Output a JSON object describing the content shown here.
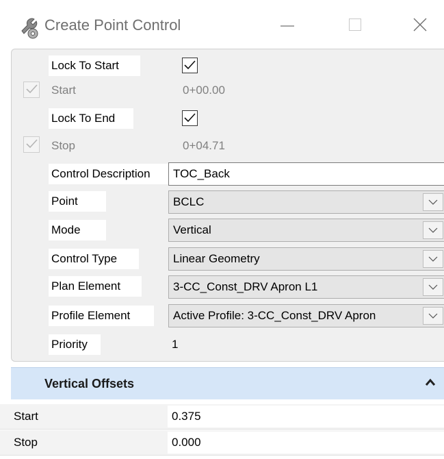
{
  "window": {
    "title": "Create Point Control",
    "icon": "tools-icon",
    "buttons": [
      "minimize-icon",
      "maximize-icon",
      "close-icon"
    ]
  },
  "properties": {
    "lock_to_start": {
      "label": "Lock To Start",
      "checked": true
    },
    "start": {
      "label": "Start",
      "value": "0+00.00",
      "locked": true
    },
    "lock_to_end": {
      "label": "Lock To End",
      "checked": true
    },
    "stop": {
      "label": "Stop",
      "value": "0+04.71",
      "locked": true
    },
    "control_description": {
      "label": "Control Description",
      "value": "TOC_Back"
    },
    "point": {
      "label": "Point",
      "value": "BCLC"
    },
    "mode": {
      "label": "Mode",
      "value": "Vertical"
    },
    "control_type": {
      "label": "Control Type",
      "value": "Linear Geometry"
    },
    "plan_element": {
      "label": "Plan Element",
      "value": "3-CC_Const_DRV Apron L1"
    },
    "profile_element": {
      "label": "Profile Element",
      "value": "Active Profile: 3-CC_Const_DRV Apron"
    },
    "priority": {
      "label": "Priority",
      "value": "1"
    }
  },
  "vertical_offsets": {
    "title": "Vertical Offsets",
    "expanded": true,
    "rows": [
      {
        "label": "Start",
        "value": "0.375"
      },
      {
        "label": "Stop",
        "value": "0.000"
      }
    ]
  },
  "colors": {
    "panel_background": "#f0f0f0",
    "section_header": "#d6e6f8",
    "disabled_text": "#808080",
    "title_text": "#6f6f6f"
  }
}
